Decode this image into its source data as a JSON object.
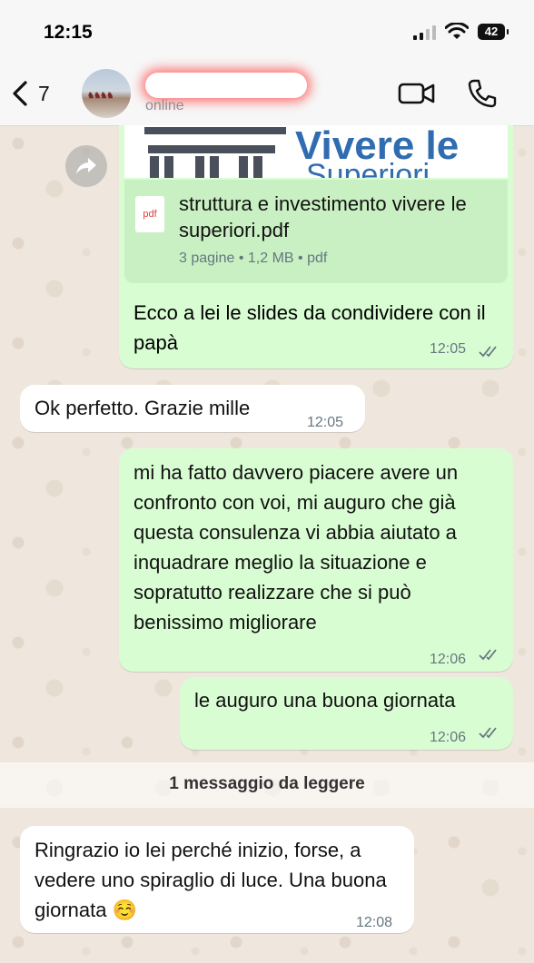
{
  "status_bar": {
    "time": "12:15",
    "battery": "42"
  },
  "header": {
    "back_count": "7",
    "contact_status": "online"
  },
  "messages": {
    "document": {
      "file_name": "struttura e investimento vivere le superiori.pdf",
      "file_info": "3 pagine • 1,2 MB • pdf",
      "icon_label": "pdf",
      "preview_title": "Vivere le",
      "preview_subtitle": "Superiori",
      "caption": "Ecco a lei le slides da condividere con il papà",
      "time": "12:05"
    },
    "incoming_1": {
      "text": "Ok perfetto. Grazie mille",
      "time": "12:05"
    },
    "outgoing_2": {
      "text": "mi ha fatto davvero piacere avere un confronto con voi, mi auguro che già questa consulenza vi abbia aiutato a inquadrare meglio la situazione e sopratutto realizzare che si può benissimo migliorare",
      "time": "12:06"
    },
    "outgoing_3": {
      "text": "le auguro una buona giornata",
      "time": "12:06"
    },
    "unread_divider": "1 messaggio da leggere",
    "incoming_2": {
      "text": "Ringrazio io lei perché inizio, forse, a vedere uno spiraglio di luce. Una buona giornata ☺️",
      "time": "12:08"
    }
  },
  "colors": {
    "outgoing_bubble": "#d9fdd3",
    "incoming_bubble": "#ffffff",
    "read_ticks": "#667781",
    "chat_background": "#efe7dd"
  },
  "icons": [
    "back-chevron-icon",
    "video-call-icon",
    "phone-icon",
    "forward-icon",
    "pdf-icon",
    "double-check-icon",
    "signal-icon",
    "wifi-icon",
    "battery-icon"
  ]
}
